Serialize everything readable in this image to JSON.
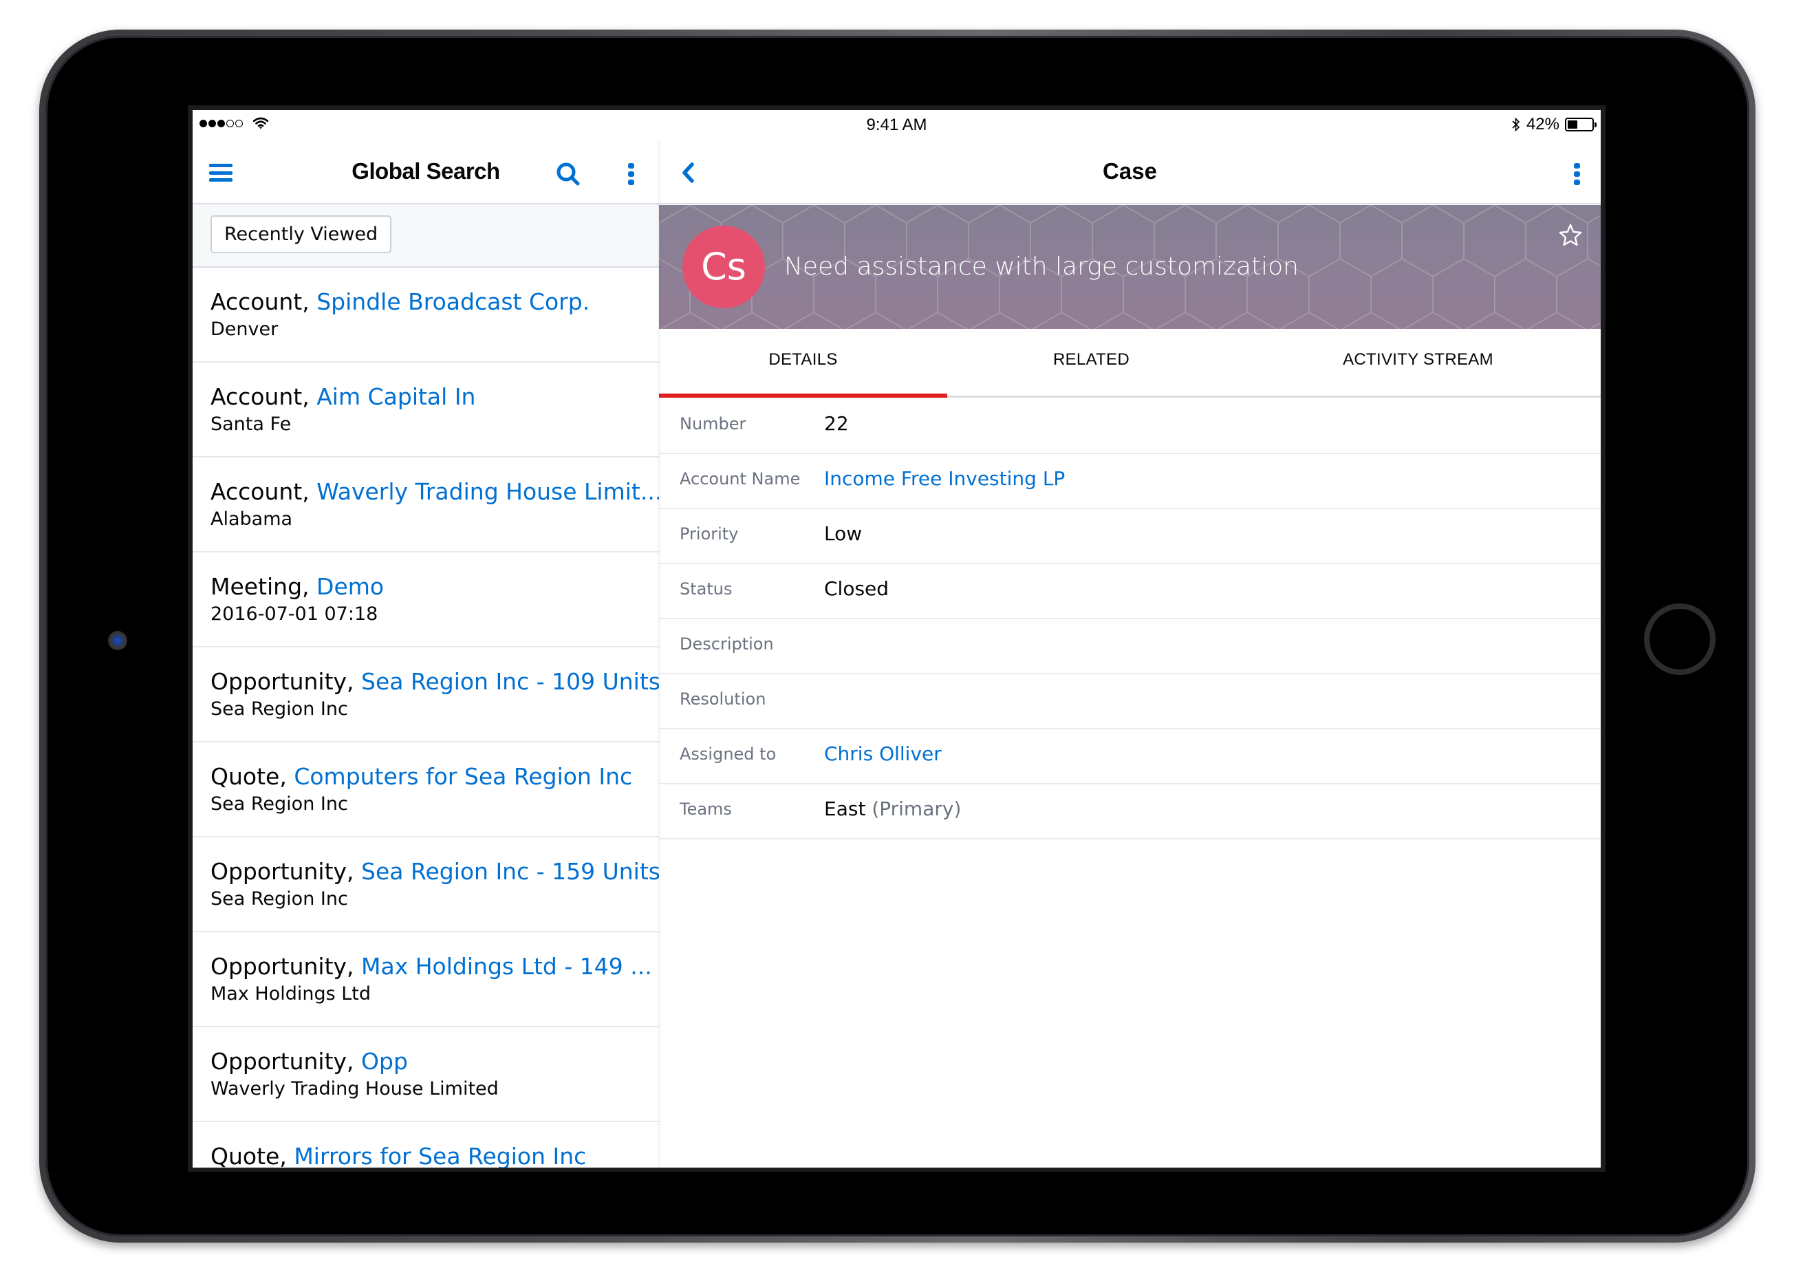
{
  "status_bar": {
    "time": "9:41 AM",
    "battery_percent": "42%",
    "battery_level": 0.42,
    "signal_bars": 3,
    "signal_total": 5
  },
  "left_panel": {
    "title": "Global Search",
    "filter_button": "Recently Viewed",
    "items": [
      {
        "type": "Account,",
        "name": "Spindle Broadcast Corp.",
        "subtitle": "Denver"
      },
      {
        "type": "Account,",
        "name": "Aim Capital In",
        "subtitle": "Santa Fe"
      },
      {
        "type": "Account,",
        "name": "Waverly Trading House Limit...",
        "subtitle": "Alabama"
      },
      {
        "type": "Meeting,",
        "name": "Demo",
        "subtitle": "2016-07-01 07:18"
      },
      {
        "type": "Opportunity,",
        "name": "Sea Region Inc - 109 Units",
        "subtitle": "Sea Region Inc"
      },
      {
        "type": "Quote,",
        "name": "Computers for Sea Region Inc",
        "subtitle": "Sea Region Inc"
      },
      {
        "type": "Opportunity,",
        "name": "Sea Region Inc - 159 Units",
        "subtitle": "Sea Region Inc"
      },
      {
        "type": "Opportunity,",
        "name": "Max Holdings Ltd - 149 ...",
        "subtitle": "Max Holdings Ltd"
      },
      {
        "type": "Opportunity,",
        "name": "Opp",
        "subtitle": "Waverly Trading House Limited"
      },
      {
        "type": "Quote,",
        "name": "Mirrors for Sea Region Inc",
        "subtitle": ""
      }
    ]
  },
  "right_panel": {
    "title": "Case",
    "avatar_initials": "Cs",
    "record_title": "Need assistance with large customization",
    "tabs": [
      {
        "label": "DETAILS",
        "active": true
      },
      {
        "label": "RELATED",
        "active": false
      },
      {
        "label": "ACTIVITY STREAM",
        "active": false
      }
    ],
    "fields": [
      {
        "label": "Number",
        "value": "22",
        "link": false,
        "suffix": ""
      },
      {
        "label": "Account Name",
        "value": "Income Free Investing LP",
        "link": true,
        "suffix": ""
      },
      {
        "label": "Priority",
        "value": "Low",
        "link": false,
        "suffix": ""
      },
      {
        "label": "Status",
        "value": "Closed",
        "link": false,
        "suffix": ""
      },
      {
        "label": "Description",
        "value": "",
        "link": false,
        "suffix": ""
      },
      {
        "label": "Resolution",
        "value": "",
        "link": false,
        "suffix": ""
      },
      {
        "label": "Assigned to",
        "value": "Chris Olliver",
        "link": true,
        "suffix": ""
      },
      {
        "label": "Teams",
        "value": "East",
        "link": false,
        "suffix": "(Primary)"
      }
    ]
  },
  "colors": {
    "accent_blue": "#0070d2",
    "active_tab_underline": "#e0201f",
    "avatar_bg": "#e5506f",
    "banner_top": "#857f94",
    "banner_bottom": "#927d94"
  },
  "icons": {
    "menu": "hamburger-icon",
    "search": "search-icon",
    "more": "kebab-icon",
    "back": "chevron-left-icon",
    "favorite": "star-outline-icon",
    "wifi": "wifi-icon",
    "bluetooth": "bluetooth-icon",
    "battery": "battery-icon"
  }
}
